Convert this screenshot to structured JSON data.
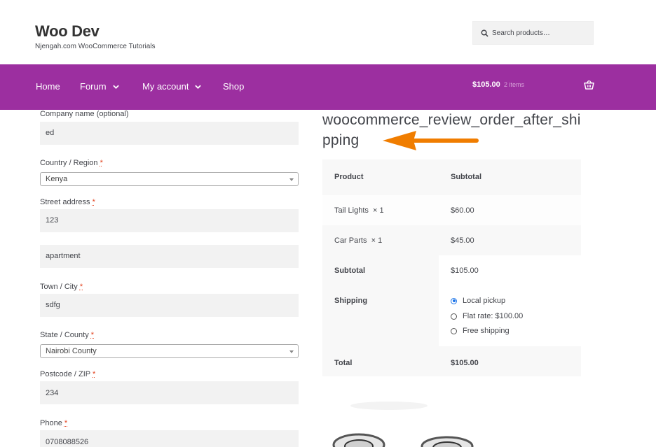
{
  "header": {
    "site_title": "Woo Dev",
    "site_description": "Njengah.com WooCommerce Tutorials",
    "search_placeholder": "Search products…",
    "search_icon": "search-icon"
  },
  "nav": {
    "items": [
      {
        "label": "Home",
        "has_dropdown": false
      },
      {
        "label": "Forum",
        "has_dropdown": true
      },
      {
        "label": "My account",
        "has_dropdown": true
      },
      {
        "label": "Shop",
        "has_dropdown": false
      }
    ],
    "cart_amount": "$105.00",
    "cart_count": "2 items",
    "cart_icon": "basket-icon"
  },
  "form": {
    "company": {
      "label": "Company name (optional)",
      "value": "ed"
    },
    "country": {
      "label": "Country / Region",
      "required": "*",
      "value": "Kenya"
    },
    "street": {
      "label": "Street address",
      "required": "*",
      "value": "123",
      "value2": "apartment"
    },
    "town": {
      "label": "Town / City",
      "required": "*",
      "value": "sdfg"
    },
    "state": {
      "label": "State / County",
      "required": "*",
      "value": "Nairobi County"
    },
    "postcode": {
      "label": "Postcode / ZIP",
      "required": "*",
      "value": "234"
    },
    "phone": {
      "label": "Phone",
      "required": "*",
      "value": "0708088526"
    }
  },
  "hook_title": "woocommerce_review_order_after_shipping",
  "order": {
    "head": {
      "product": "Product",
      "subtotal": "Subtotal"
    },
    "items": [
      {
        "name": "Tail Lights",
        "qty": "× 1",
        "price": "$60.00"
      },
      {
        "name": "Car Parts",
        "qty": "× 1",
        "price": "$45.00"
      }
    ],
    "subtotal_label": "Subtotal",
    "subtotal_value": "$105.00",
    "shipping_label": "Shipping",
    "shipping_options": [
      {
        "label": "Local pickup",
        "checked": true
      },
      {
        "label": "Flat rate: $100.00",
        "checked": false
      },
      {
        "label": "Free shipping",
        "checked": false
      }
    ],
    "total_label": "Total",
    "total_value": "$105.00"
  },
  "colors": {
    "nav_bg": "#9c2fa0",
    "arrow": "#f07d00",
    "required": "#e2401c",
    "radio_checked": "#1a73e8"
  }
}
